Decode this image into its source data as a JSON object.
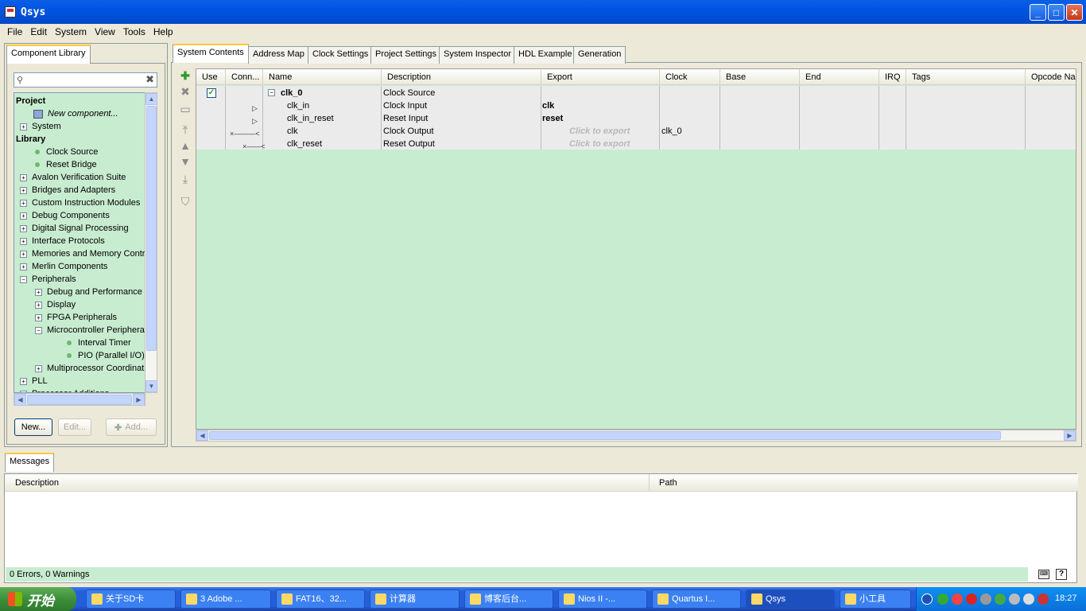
{
  "window": {
    "title": "Qsys"
  },
  "menu": [
    "File",
    "Edit",
    "System",
    "View",
    "Tools",
    "Help"
  ],
  "left_panel": {
    "tab": "Component Library",
    "search_placeholder": "",
    "tree": [
      {
        "label": "Project",
        "bold": true,
        "level": 0,
        "kind": "header"
      },
      {
        "label": "New component...",
        "level": 1,
        "kind": "newcomp"
      },
      {
        "label": "System",
        "level": 0,
        "kind": "plus"
      },
      {
        "label": "Library",
        "bold": true,
        "level": 0,
        "kind": "header"
      },
      {
        "label": "Clock Source",
        "level": 1,
        "kind": "dot"
      },
      {
        "label": "Reset Bridge",
        "level": 1,
        "kind": "dot"
      },
      {
        "label": "Avalon Verification Suite",
        "level": 0,
        "kind": "plus"
      },
      {
        "label": "Bridges and Adapters",
        "level": 0,
        "kind": "plus"
      },
      {
        "label": "Custom Instruction Modules",
        "level": 0,
        "kind": "plus"
      },
      {
        "label": "Debug Components",
        "level": 0,
        "kind": "plus"
      },
      {
        "label": "Digital Signal Processing",
        "level": 0,
        "kind": "plus"
      },
      {
        "label": "Interface Protocols",
        "level": 0,
        "kind": "plus"
      },
      {
        "label": "Memories and Memory Contro",
        "level": 0,
        "kind": "plus"
      },
      {
        "label": "Merlin Components",
        "level": 0,
        "kind": "plus"
      },
      {
        "label": "Peripherals",
        "level": 0,
        "kind": "minus"
      },
      {
        "label": "Debug and Performance",
        "level": 1,
        "kind": "plus"
      },
      {
        "label": "Display",
        "level": 1,
        "kind": "plus"
      },
      {
        "label": "FPGA Peripherals",
        "level": 1,
        "kind": "plus"
      },
      {
        "label": "Microcontroller Peripherals",
        "level": 1,
        "kind": "minus"
      },
      {
        "label": "Interval Timer",
        "level": 3,
        "kind": "dot"
      },
      {
        "label": "PIO (Parallel I/O)",
        "level": 3,
        "kind": "dot"
      },
      {
        "label": "Multiprocessor Coordinati",
        "level": 1,
        "kind": "plus"
      },
      {
        "label": "PLL",
        "level": 0,
        "kind": "plus"
      },
      {
        "label": "Processor Additions",
        "level": 0,
        "kind": "plus"
      }
    ],
    "buttons": {
      "new": "New...",
      "edit": "Edit...",
      "add": "Add..."
    }
  },
  "main_tabs": [
    "System Contents",
    "Address Map",
    "Clock Settings",
    "Project Settings",
    "System Inspector",
    "HDL Example",
    "Generation"
  ],
  "grid": {
    "columns": [
      "Use",
      "Conn...",
      "Name",
      "Description",
      "Export",
      "Clock",
      "Base",
      "End",
      "IRQ",
      "Tags",
      "Opcode Nar"
    ],
    "rows": [
      {
        "name": "clk_0",
        "description": "Clock Source",
        "export": "",
        "clock": "",
        "top": true
      },
      {
        "name": "clk_in",
        "description": "Clock Input",
        "export": "clk",
        "clock": ""
      },
      {
        "name": "clk_in_reset",
        "description": "Reset Input",
        "export": "reset",
        "clock": ""
      },
      {
        "name": "clk",
        "description": "Clock Output",
        "export": "Click to export",
        "clock": "clk_0",
        "hint": true
      },
      {
        "name": "clk_reset",
        "description": "Reset Output",
        "export": "Click to export",
        "clock": "",
        "hint": true
      }
    ]
  },
  "messages": {
    "tab": "Messages",
    "columns": [
      "Description",
      "Path"
    ],
    "status": "0 Errors, 0 Warnings"
  },
  "taskbar": {
    "start": "开始",
    "items": [
      "关于SD卡",
      "3 Adobe ...",
      "FAT16、32...",
      "计算器",
      "博客后台...",
      "Nios II -...",
      "Quartus I...",
      "Qsys",
      "小工具"
    ],
    "clock": "18:27"
  },
  "colors": {
    "grid_bg": "#c8ecd0",
    "title_blue": "#0054e3",
    "status_green": "#c8ecd0"
  }
}
